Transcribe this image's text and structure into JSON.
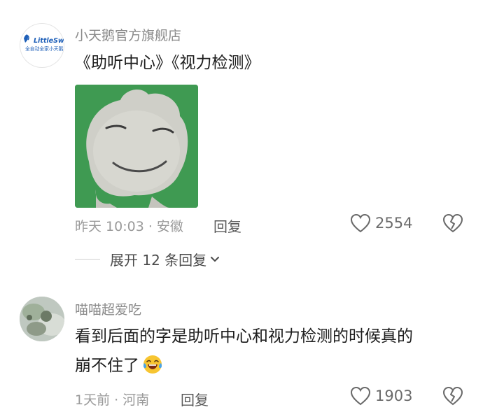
{
  "comments": [
    {
      "username": "小天鹅官方旗舰店",
      "avatar_text": "LittleSwan",
      "avatar_subtext": "全自动全家小天鹅",
      "text": "《助听中心》《视力检测》",
      "has_sticker": true,
      "meta": "昨天 10:03 · 安徽",
      "reply_label": "回复",
      "likes": "2554",
      "expand_label": "展开 12 条回复"
    },
    {
      "username": "喵喵超爱吃",
      "text_line1": "看到后面的字是助听中心和视力检测的时候真的",
      "text_line2": "崩不住了",
      "emoji": "laughing-crying",
      "meta": "1天前 · 河南",
      "reply_label": "回复",
      "likes": "1903"
    }
  ],
  "colors": {
    "sticker_bg": "#3f9a52",
    "muted_text": "#9a9a9a",
    "body_text": "#1e1e1e"
  }
}
